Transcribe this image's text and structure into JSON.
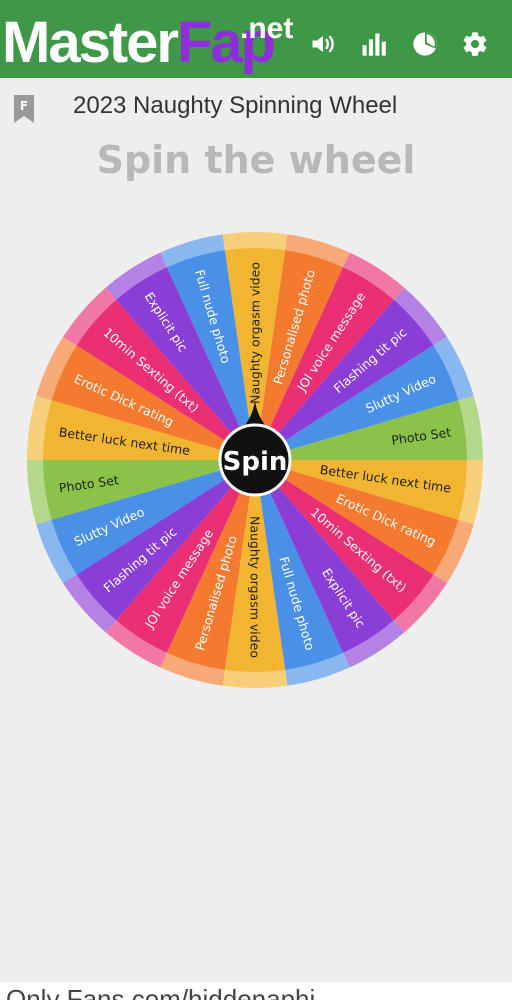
{
  "header": {
    "logo_main": "Master",
    "logo_accent": "Fap",
    "logo_tld": ".net",
    "icons": [
      "sound-icon",
      "stats-icon",
      "pie-chart-icon",
      "settings-icon"
    ]
  },
  "title": {
    "bookmark_letter": "F",
    "text": "2023 Naughty Spinning Wheel"
  },
  "heading": "Spin the wheel",
  "wheel": {
    "center_label": "Spin",
    "segments": [
      {
        "label": "Naughty orgasm video",
        "color": "#f2b531"
      },
      {
        "label": "Personalised photo",
        "color": "#f37a2e"
      },
      {
        "label": "JOI voice message",
        "color": "#ea2f74"
      },
      {
        "label": "Flashing tit pic",
        "color": "#8a3ed6"
      },
      {
        "label": "Slutty Video",
        "color": "#4a90e6"
      },
      {
        "label": "Photo Set",
        "color": "#8bc34a"
      },
      {
        "label": "Better luck next time",
        "color": "#f2b531"
      },
      {
        "label": "Erotic Dick rating",
        "color": "#f37a2e"
      },
      {
        "label": "10min Sexting (txt)",
        "color": "#ea2f74"
      },
      {
        "label": "Explicit pic",
        "color": "#8a3ed6"
      },
      {
        "label": "Full nude photo",
        "color": "#4a90e6"
      },
      {
        "label": "Naughty orgasm video",
        "color": "#f2b531"
      },
      {
        "label": "Personalised photo",
        "color": "#f37a2e"
      },
      {
        "label": "JOI voice message",
        "color": "#ea2f74"
      },
      {
        "label": "Flashing tit pic",
        "color": "#8a3ed6"
      },
      {
        "label": "Slutty Video",
        "color": "#4a90e6"
      },
      {
        "label": "Photo Set",
        "color": "#8bc34a"
      },
      {
        "label": "Better luck next time",
        "color": "#f2b531"
      },
      {
        "label": "Erotic Dick rating",
        "color": "#f37a2e"
      },
      {
        "label": "10min Sexting (txt)",
        "color": "#ea2f74"
      },
      {
        "label": "Explicit pic",
        "color": "#8a3ed6"
      },
      {
        "label": "Full nude photo",
        "color": "#4a90e6"
      }
    ]
  },
  "colors": {
    "header_bg": "#3f9847",
    "accent": "#8e2fd9"
  },
  "footer": {
    "text": "Only Fans.com/hiddenaphi"
  }
}
